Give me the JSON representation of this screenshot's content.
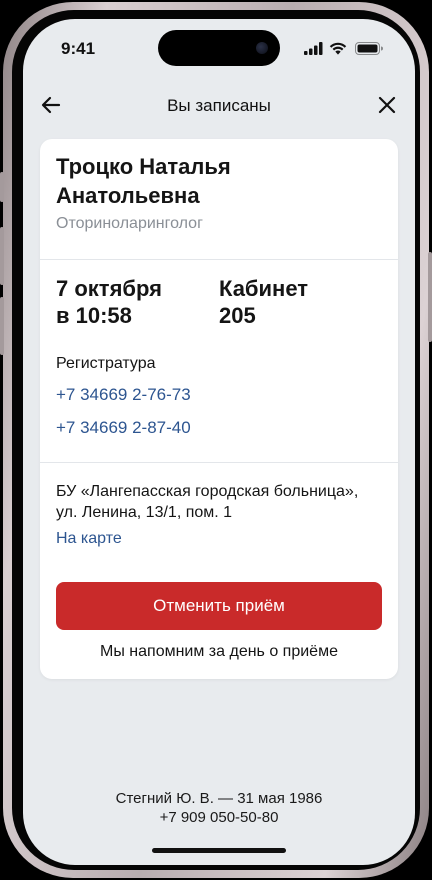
{
  "status_bar": {
    "time": "9:41",
    "icons": [
      "cellular-signal-icon",
      "wifi-icon",
      "battery-icon"
    ]
  },
  "nav": {
    "title": "Вы записаны",
    "back_icon": "arrow-left-icon",
    "close_icon": "close-icon"
  },
  "doctor": {
    "name": "Троцко Наталья Анатольевна",
    "specialty": "Оториноларинголог"
  },
  "appointment": {
    "date": "7 октября",
    "time": "в 10:58",
    "room_label": "Кабинет",
    "room_number": "205"
  },
  "registry": {
    "label": "Регистратура",
    "phones": [
      "+7 34669 2-76-73",
      "+7 34669 2-87-40"
    ]
  },
  "location": {
    "address": "БУ «Лангепасская городская больница», ул. Ленина, 13/1, пом. 1",
    "map_link": "На карте"
  },
  "actions": {
    "cancel_label": "Отменить приём",
    "reminder_text": "Мы напомним за день о приёме"
  },
  "footer": {
    "line1": "Стегний Ю. В. — 31 мая 1986",
    "line2": "+7 909 050-50-80"
  },
  "colors": {
    "accent_red": "#c92a2a",
    "link_blue": "#2d5590",
    "screen_bg": "#e8ebee",
    "card_bg": "#ffffff"
  }
}
